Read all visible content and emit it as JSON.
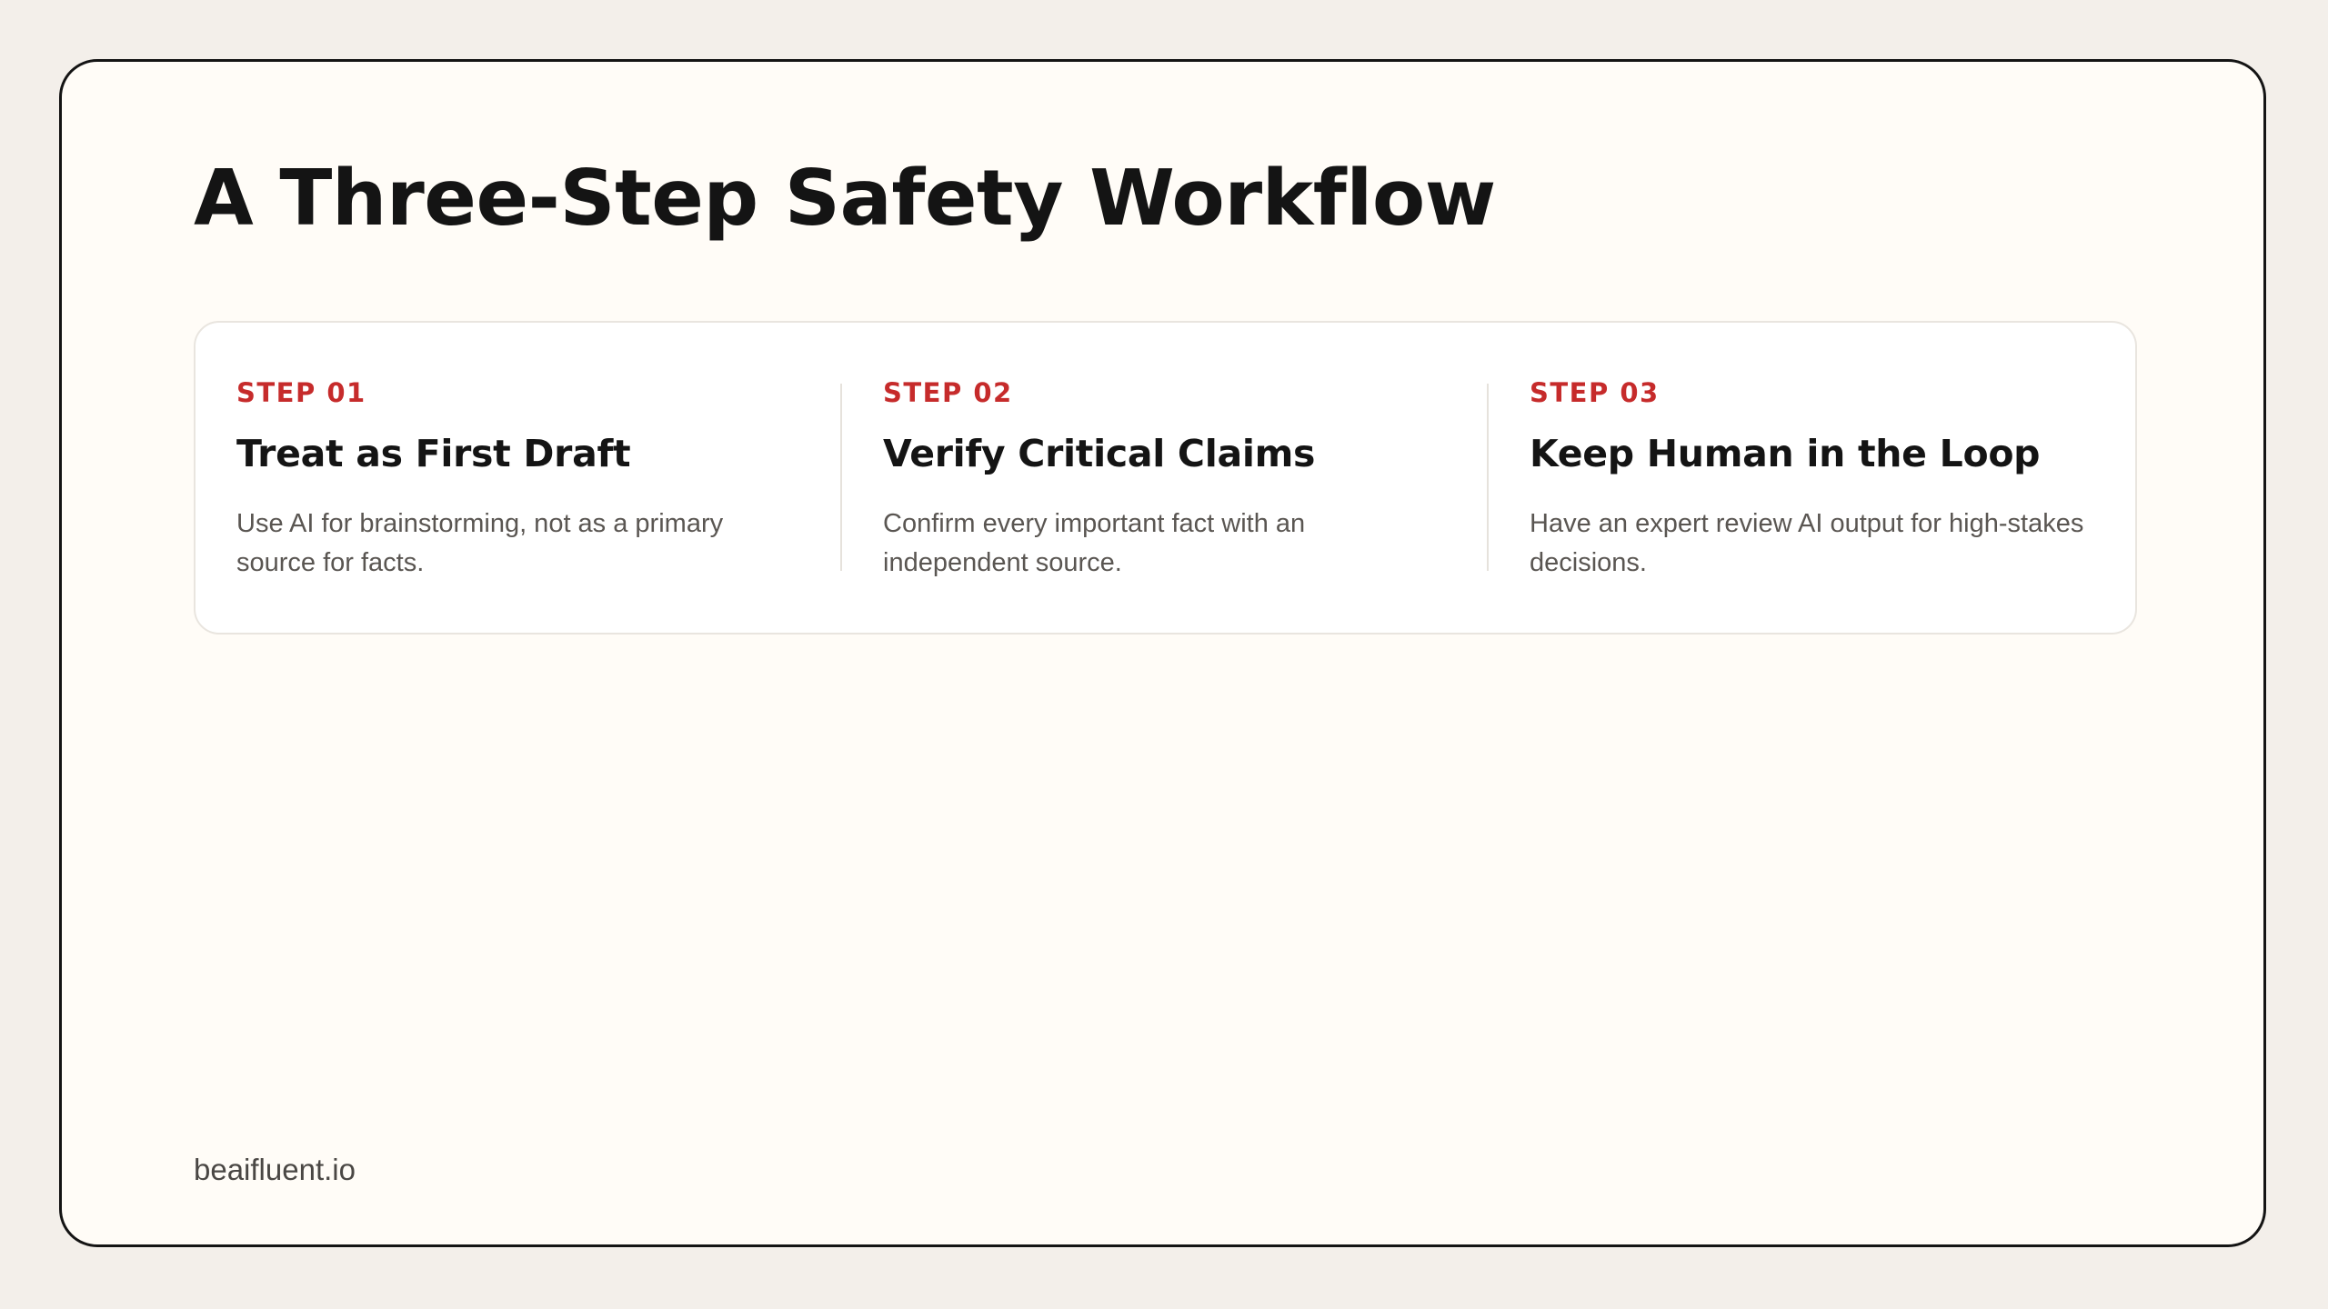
{
  "slide": {
    "title": "A Three-Step Safety Workflow",
    "steps": [
      {
        "label": "STEP 01",
        "heading": "Treat as First Draft",
        "description": "Use AI for brainstorming, not as a primary source for facts."
      },
      {
        "label": "STEP 02",
        "heading": "Verify Critical Claims",
        "description": "Confirm every important fact with an independent source."
      },
      {
        "label": "STEP 03",
        "heading": "Keep Human in the Loop",
        "description": "Have an expert review AI output for high-stakes decisions."
      }
    ],
    "footer": "beaifluent.io"
  },
  "colors": {
    "page_background": "#f3efea",
    "slide_background": "#fffcf7",
    "accent_red": "#c62b2b",
    "heading_text": "#141414",
    "body_text": "#5a5652"
  }
}
